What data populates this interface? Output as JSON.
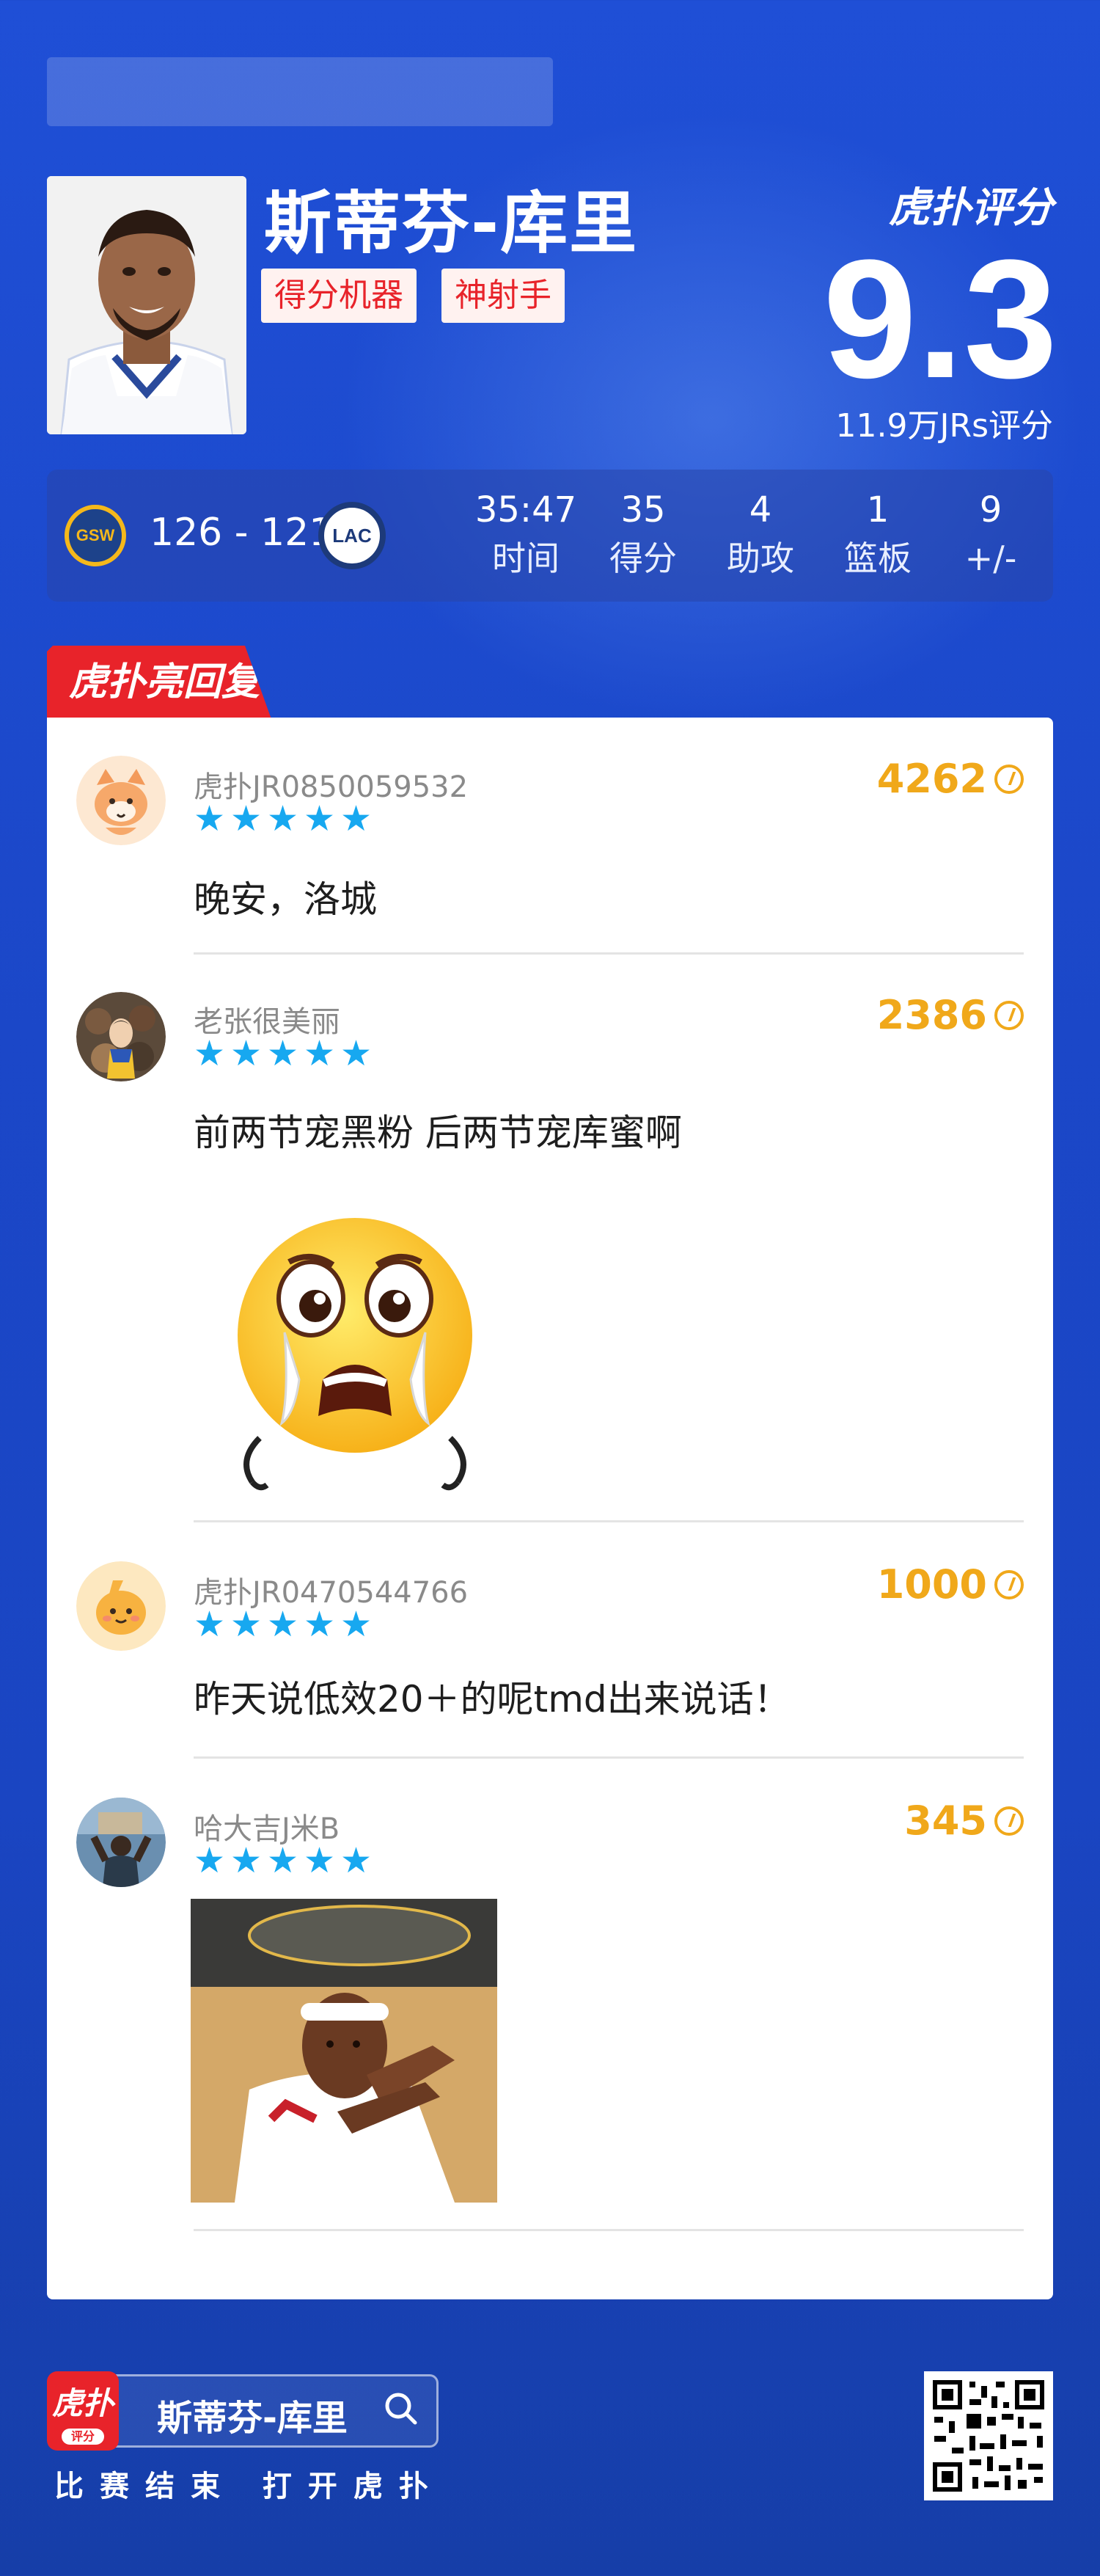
{
  "header": {
    "player_name": "斯蒂芬-库里",
    "tags": [
      "得分机器",
      "神射手"
    ],
    "brand": "虎扑评分",
    "score": "9.3",
    "rating_count": "11.9万JRs评分"
  },
  "game": {
    "home_team": "GSW",
    "away_team": "LAC",
    "score": "126 - 121",
    "stats": [
      {
        "value": "35:47",
        "label": "时间"
      },
      {
        "value": "35",
        "label": "得分"
      },
      {
        "value": "4",
        "label": "助攻"
      },
      {
        "value": "1",
        "label": "篮板"
      },
      {
        "value": "9",
        "label": "+/-"
      }
    ]
  },
  "section_title": "虎扑亮回复",
  "comments": [
    {
      "username": "虎扑JR0850059532",
      "likes": "4262",
      "text": "晚安，洛城"
    },
    {
      "username": "老张很美丽",
      "likes": "2386",
      "text": "前两节宠黑粉 后两节宠库蜜啊"
    },
    {
      "username": "虎扑JR0470544766",
      "likes": "1000",
      "text": "昨天说低效20＋的呢tmd出来说话！"
    },
    {
      "username": "哈大吉J米B",
      "likes": "345",
      "text": ""
    }
  ],
  "footer": {
    "app_icon_label": "虎扑",
    "app_icon_sub": "评分",
    "search_text": "斯蒂芬-库里",
    "caption": "比赛结束 打开虎扑"
  },
  "colors": {
    "accent_red": "#e8232a",
    "star_blue": "#17a8f0",
    "likes_gold": "#f0a81a",
    "background_blue": "#1f4fd6"
  }
}
